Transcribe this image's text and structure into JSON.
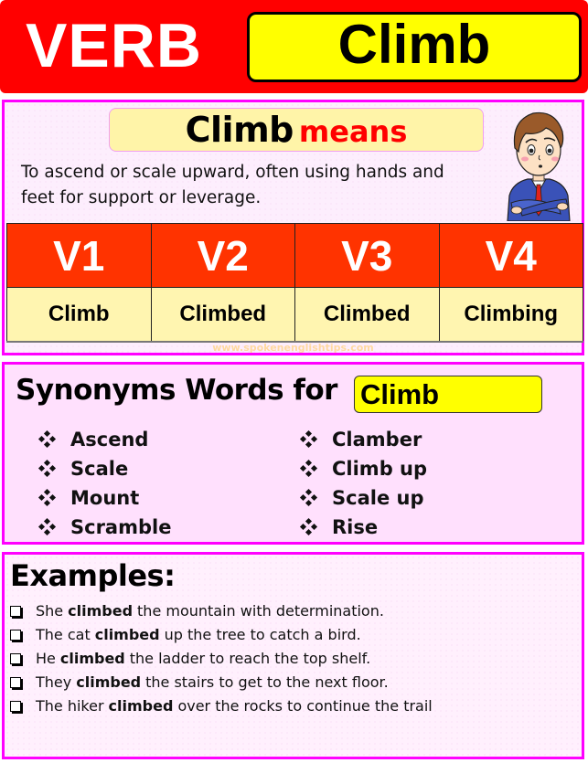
{
  "header": {
    "category": "VERB",
    "word": "Climb"
  },
  "meaning": {
    "word": "Climb",
    "label": "means",
    "definition": "To ascend or scale upward, often using hands and feet for support or leverage.",
    "avatar_icon": "confused-man-arms-crossed"
  },
  "forms": {
    "headers": [
      "V1",
      "V2",
      "V3",
      "V4"
    ],
    "values": [
      "Climb",
      "Climbed",
      "Climbed",
      "Climbing"
    ]
  },
  "watermark": "www.spokenenglishtips.com",
  "synonyms": {
    "title": "Synonyms Words for",
    "word": "Climb",
    "bullet_icon": "four-diamond-bullet",
    "left": [
      "Ascend",
      "Scale",
      "Mount",
      "Scramble"
    ],
    "right": [
      "Clamber",
      "Climb up",
      "Scale up",
      "Rise"
    ]
  },
  "examples": {
    "title": "Examples:",
    "bullet_icon": "shadowed-checkbox",
    "items": [
      {
        "before": "She",
        "verb": "climbed",
        "after": "the mountain with determination."
      },
      {
        "before": "The cat",
        "verb": "climbed",
        "after": "up the tree to catch a bird."
      },
      {
        "before": "He",
        "verb": "climbed",
        "after": "the ladder to reach the top shelf."
      },
      {
        "before": "They",
        "verb": "climbed",
        "after": "the stairs to get to the next floor."
      },
      {
        "before": "The hiker",
        "verb": "climbed",
        "after": "over the rocks to continue the trail"
      }
    ]
  },
  "colors": {
    "header_red": "#ff0000",
    "highlight_yellow": "#ffff00",
    "section_border": "#ff00ff",
    "table_header": "#ff3300",
    "table_cell": "#fff5b0",
    "means_red": "#ff0000"
  }
}
